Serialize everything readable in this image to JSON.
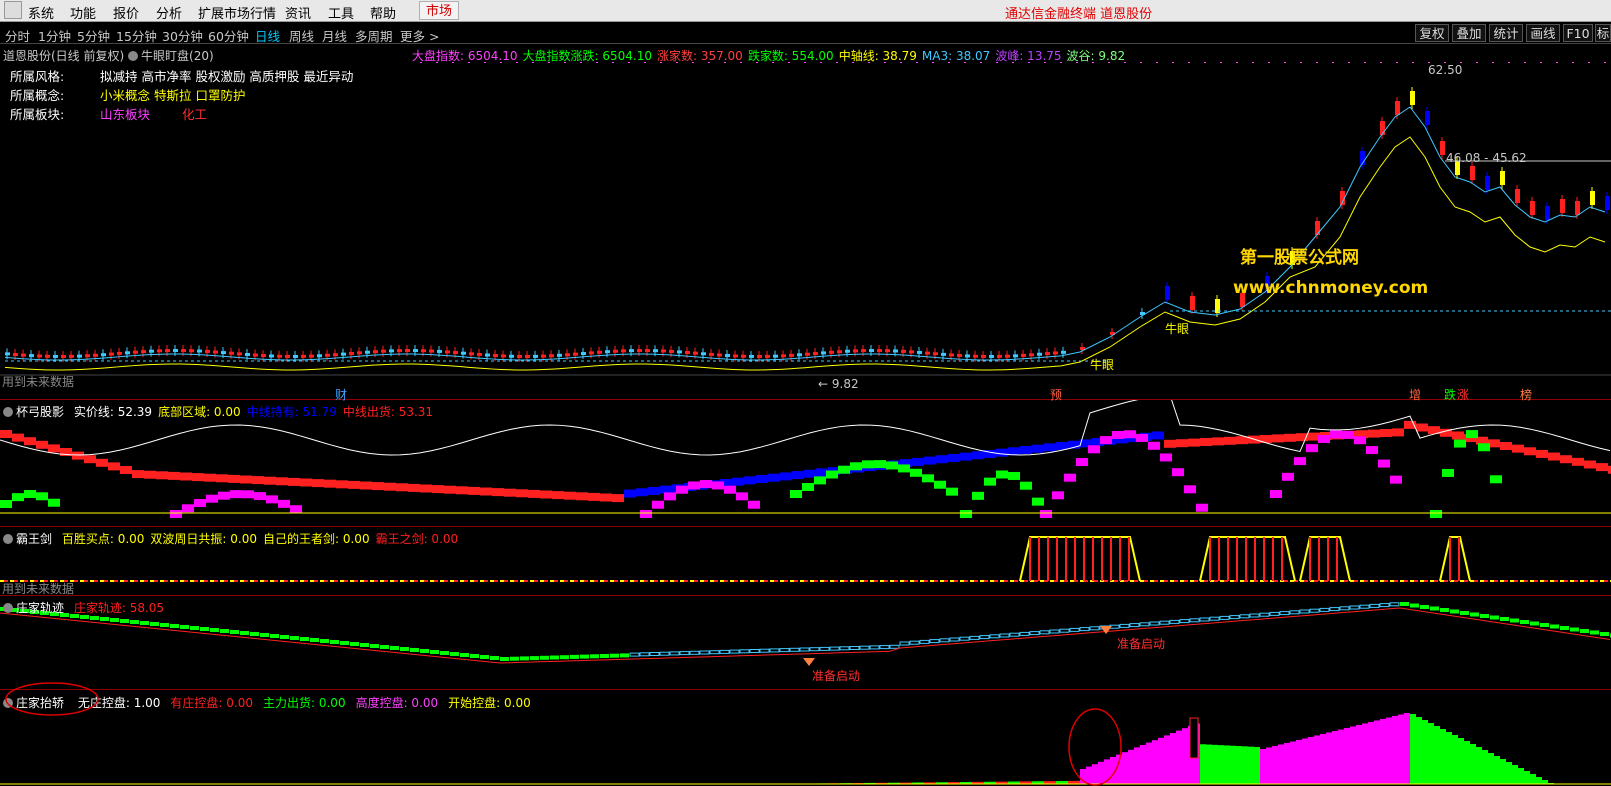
{
  "menu": {
    "items": [
      "系统",
      "功能",
      "报价",
      "分析",
      "扩展市场行情",
      "资讯",
      "工具",
      "帮助"
    ],
    "market": "市场",
    "app_title": "通达信金融终端  道恩股份"
  },
  "periods": {
    "items": [
      "分时",
      "1分钟",
      "5分钟",
      "15分钟",
      "30分钟",
      "60分钟",
      "日线",
      "周线",
      "月线",
      "多周期",
      "更多 >"
    ],
    "active": "日线"
  },
  "toolbar": {
    "items": [
      "复权",
      "叠加",
      "统计",
      "画线",
      "F10",
      "标记"
    ]
  },
  "main_panel": {
    "stock": "道恩股份(日线 前复权)",
    "indicator": "牛眼盯盘(20)",
    "readouts": [
      {
        "label": "大盘指数:",
        "value": "6504.10",
        "color": "#ff40ff"
      },
      {
        "label": "大盘指数涨跌:",
        "value": "6504.10",
        "color": "#00ff00"
      },
      {
        "label": "涨家数:",
        "value": "357.00",
        "color": "#ff4040"
      },
      {
        "label": "跌家数:",
        "value": "554.00",
        "color": "#00ff00"
      },
      {
        "label": "中轴线:",
        "value": "38.79",
        "color": "#ffff00"
      },
      {
        "label": "MA3:",
        "value": "38.07",
        "color": "#40c8ff"
      },
      {
        "label": "波峰:",
        "value": "13.75",
        "color": "#c040ff"
      },
      {
        "label": "波谷:",
        "value": "9.82",
        "color": "#80ff80"
      }
    ],
    "info": [
      {
        "label": "所属风格:",
        "value": "拟减持 高市净率 股权激励 高质押股 最近异动",
        "color": "#ffffff"
      },
      {
        "label": "所属概念:",
        "value": "小米概念 特斯拉 口罩防护",
        "color": "#ffff00"
      },
      {
        "label": "所属板块:",
        "value": "山东板块",
        "value2": "化工",
        "color": "#ff40ff",
        "color2": "#ff3030"
      }
    ],
    "high_label": "62.50",
    "range_label": "46.08 - 45.62",
    "low_label": "← 9.82",
    "watermark1": "第一股票公式网",
    "watermark2": "www.chnmoney.com",
    "future_warning": "用到未来数据",
    "niu1": "牛眼",
    "niu2": "牛眼",
    "markers": [
      {
        "text": "财",
        "color": "#40a0ff"
      },
      {
        "text": "预",
        "color": "#ff6040"
      },
      {
        "text": "增",
        "color": "#ff6040"
      },
      {
        "text": "跌",
        "color": "#00ff00"
      },
      {
        "text": "涨",
        "color": "#ff3030"
      },
      {
        "text": "榜",
        "color": "#ff8040"
      }
    ]
  },
  "panel2": {
    "name": "杯弓股影",
    "readouts": [
      {
        "label": "实价线:",
        "value": "52.39",
        "color": "#ffffff"
      },
      {
        "label": "底部区域:",
        "value": "0.00",
        "color": "#ffff00"
      },
      {
        "label": "中线持有:",
        "value": "51.79",
        "color": "#0000ff"
      },
      {
        "label": "中线出货:",
        "value": "53.31",
        "color": "#ff2020"
      }
    ]
  },
  "panel3": {
    "name": "霸王剑",
    "readouts": [
      {
        "label": "百胜买点:",
        "value": "0.00",
        "color": "#ffff00"
      },
      {
        "label": "双波周日共振:",
        "value": "0.00",
        "color": "#ffff00"
      },
      {
        "label": "自己的王者剑:",
        "value": "0.00",
        "color": "#ffff00"
      },
      {
        "label": "霸王之剑:",
        "value": "0.00",
        "color": "#ff2020"
      }
    ],
    "future_warning": "用到未来数据"
  },
  "panel4": {
    "name": "庄家轨迹",
    "readouts": [
      {
        "label": "庄家轨迹:",
        "value": "58.05",
        "color": "#ff2020"
      }
    ],
    "signal1": "准备启动",
    "signal2": "准备启动"
  },
  "panel5": {
    "name": "庄家抬轿",
    "readouts": [
      {
        "label": "无庄控盘:",
        "value": "1.00",
        "color": "#ffffff"
      },
      {
        "label": "有庄控盘:",
        "value": "0.00",
        "color": "#ff2020"
      },
      {
        "label": "主力出货:",
        "value": "0.00",
        "color": "#00ff00"
      },
      {
        "label": "高度控盘:",
        "value": "0.00",
        "color": "#ff40ff"
      },
      {
        "label": "开始控盘:",
        "value": "0.00",
        "color": "#ffff00"
      }
    ]
  },
  "colors": {
    "up": "#ff2020",
    "down": "#0000ff",
    "yellow": "#ffff00",
    "green": "#00ff00",
    "magenta": "#ff00ff",
    "cyan": "#40c8ff"
  }
}
